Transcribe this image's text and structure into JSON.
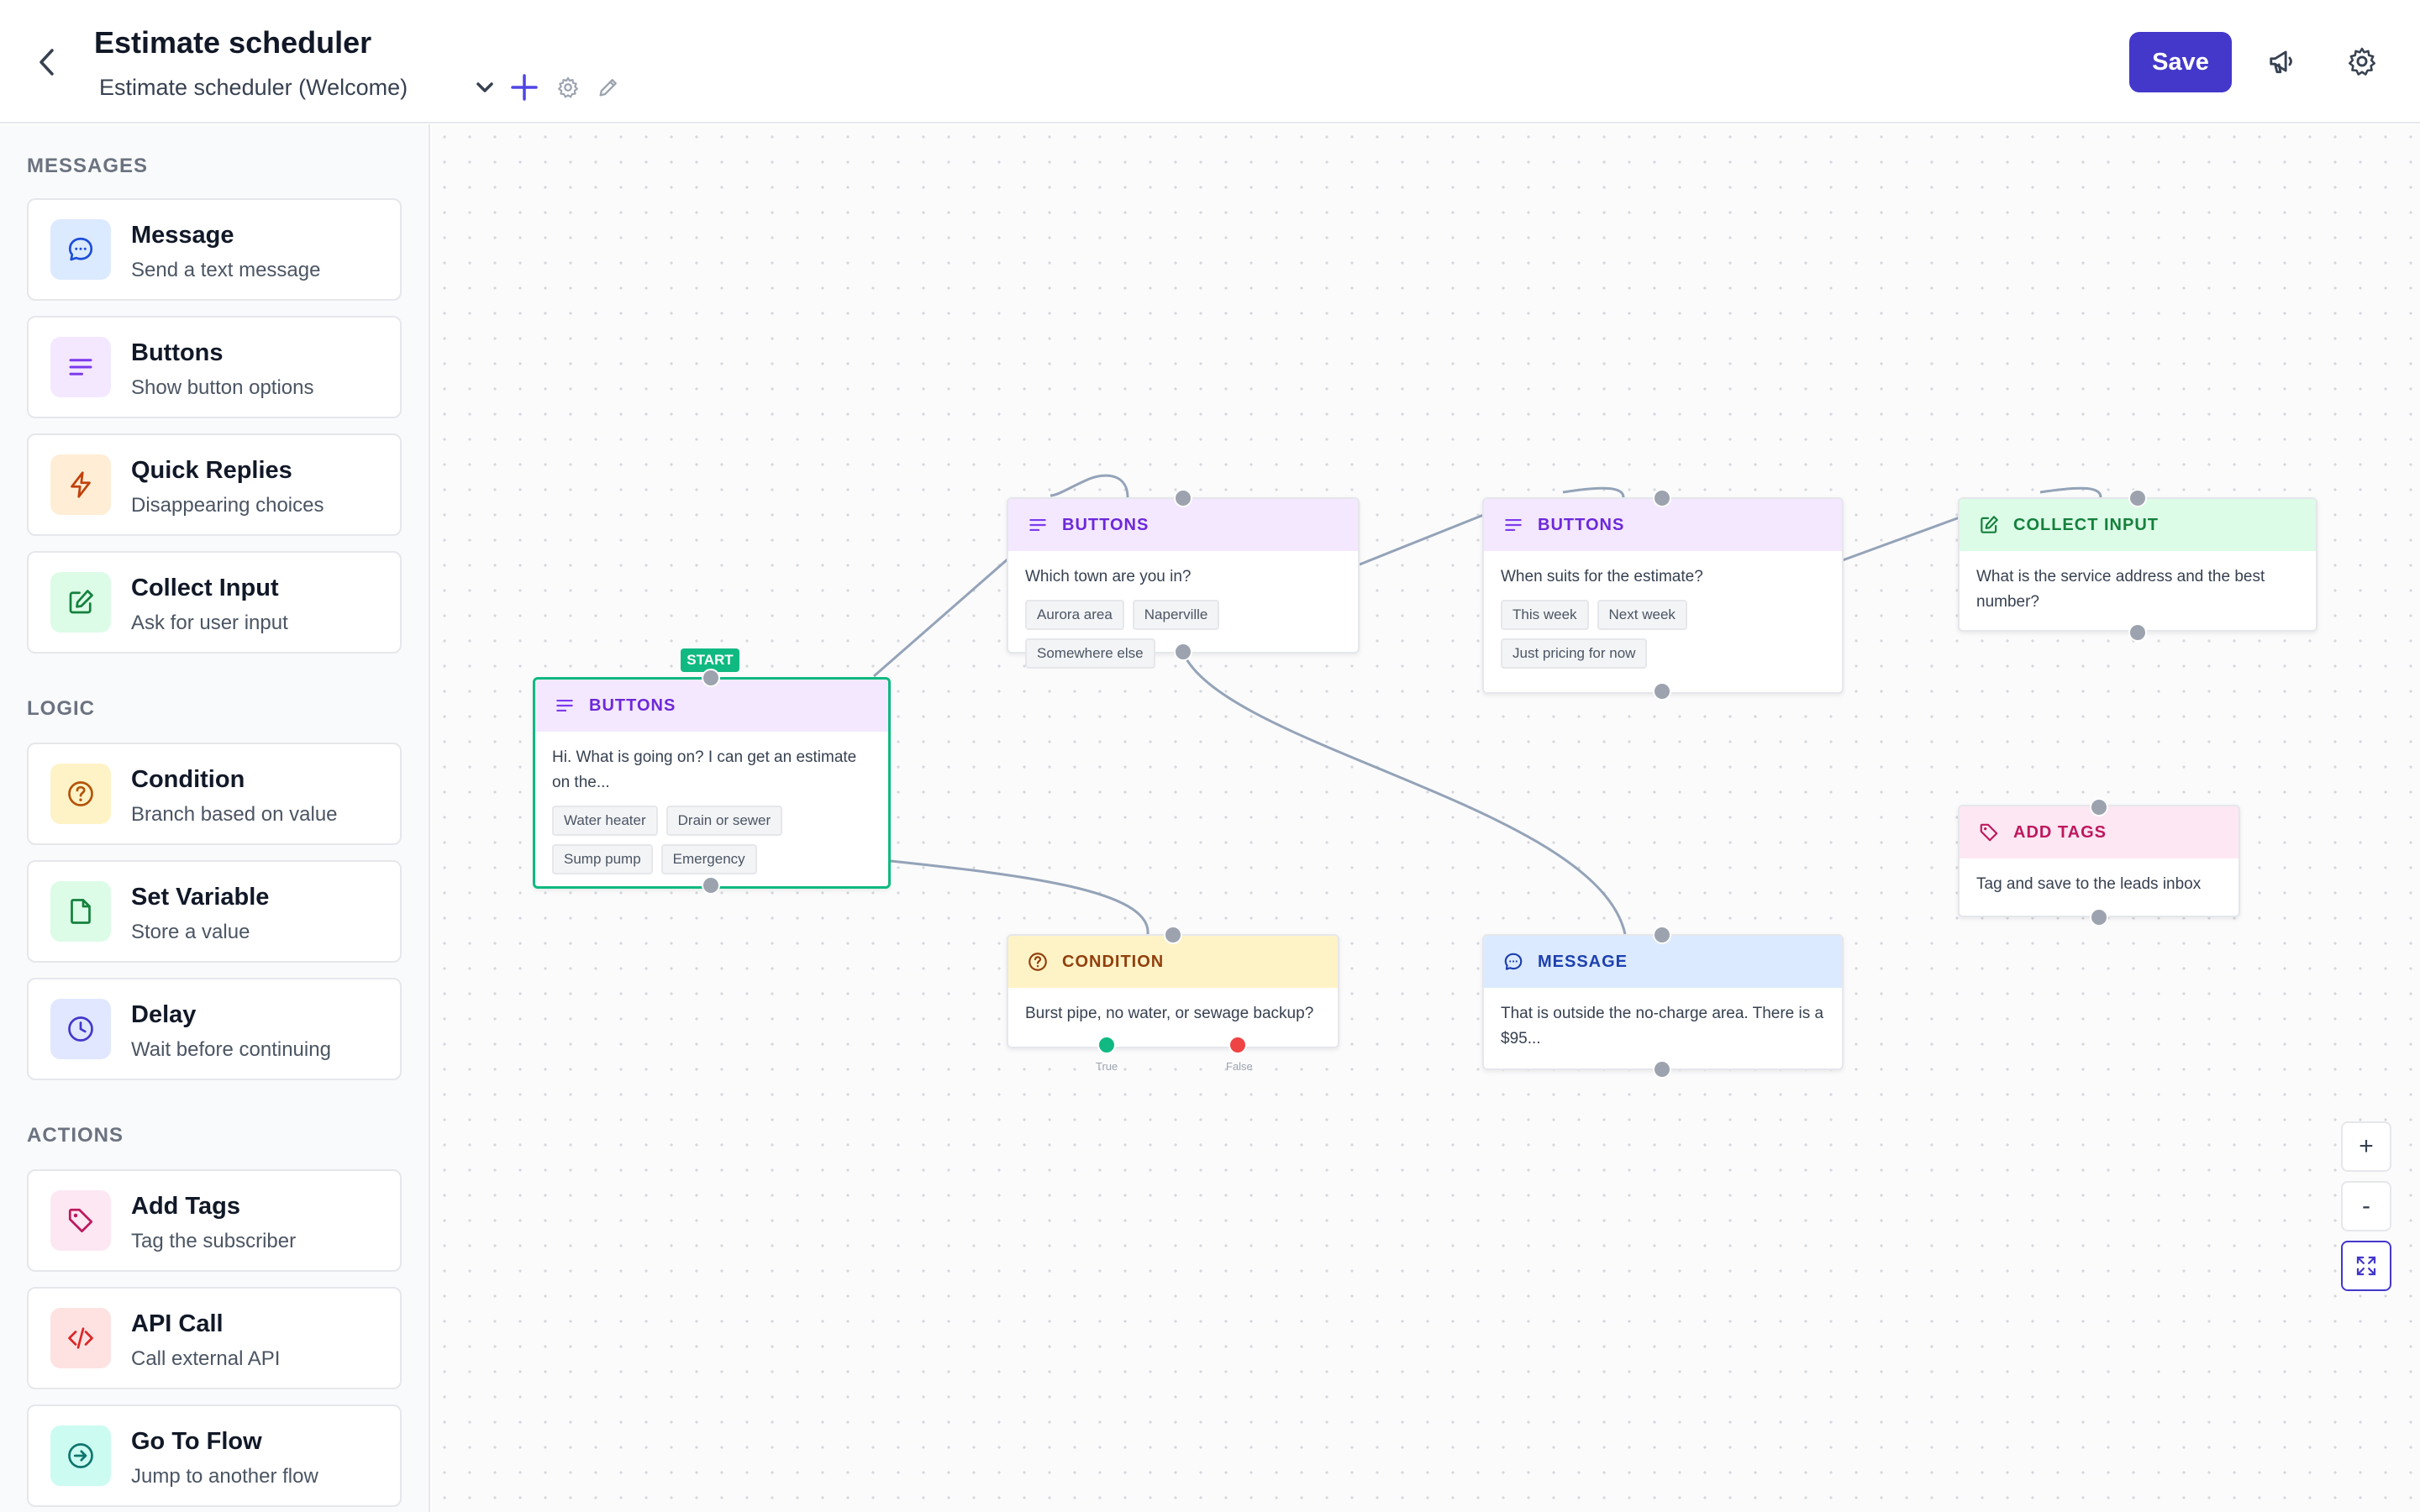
{
  "header": {
    "title": "Estimate scheduler",
    "flow_selector": "Estimate scheduler (Welcome)",
    "save_label": "Save"
  },
  "sidebar": {
    "sections": [
      {
        "title": "MESSAGES"
      },
      {
        "title": "LOGIC"
      },
      {
        "title": "ACTIONS"
      }
    ],
    "items": [
      {
        "title": "Message",
        "subtitle": "Send a text message",
        "icon": "chat-bubble-icon"
      },
      {
        "title": "Buttons",
        "subtitle": "Show button options",
        "icon": "list-lines-icon"
      },
      {
        "title": "Quick Replies",
        "subtitle": "Disappearing choices",
        "icon": "lightning-icon"
      },
      {
        "title": "Collect Input",
        "subtitle": "Ask for user input",
        "icon": "edit-square-icon"
      },
      {
        "title": "Condition",
        "subtitle": "Branch based on value",
        "icon": "question-circle-icon"
      },
      {
        "title": "Set Variable",
        "subtitle": "Store a value",
        "icon": "file-icon"
      },
      {
        "title": "Delay",
        "subtitle": "Wait before continuing",
        "icon": "clock-icon"
      },
      {
        "title": "Add Tags",
        "subtitle": "Tag the subscriber",
        "icon": "tag-icon"
      },
      {
        "title": "API Call",
        "subtitle": "Call external API",
        "icon": "code-icon"
      },
      {
        "title": "Go To Flow",
        "subtitle": "Jump to another flow",
        "icon": "arrow-circle-right-icon"
      }
    ]
  },
  "canvas": {
    "start_badge": "START",
    "nodes": [
      {
        "type": "BUTTONS",
        "text": "Hi. What is going on? I can get an estimate on the...",
        "buttons": [
          "Water heater",
          "Drain or sewer",
          "Sump pump",
          "Emergency"
        ]
      },
      {
        "type": "BUTTONS",
        "text": "Which town are you in?",
        "buttons": [
          "Aurora area",
          "Naperville",
          "Somewhere else"
        ]
      },
      {
        "type": "BUTTONS",
        "text": "When suits for the estimate?",
        "buttons": [
          "This week",
          "Next week",
          "Just pricing for now"
        ]
      },
      {
        "type": "COLLECT INPUT",
        "text": "What is the service address and the best number?"
      },
      {
        "type": "ADD TAGS",
        "text": "Tag and save to the leads inbox"
      },
      {
        "type": "CONDITION",
        "text": "Burst pipe, no water, or sewage backup?",
        "true_label": "True",
        "false_label": "False"
      },
      {
        "type": "MESSAGE",
        "text": "That is outside the no-charge area. There is a $95..."
      }
    ]
  },
  "zoom": {
    "in": "+",
    "out": "-"
  },
  "colors": {
    "accent": "#4338ca",
    "start": "#10b981",
    "true": "#10b981",
    "false": "#ef4444"
  }
}
